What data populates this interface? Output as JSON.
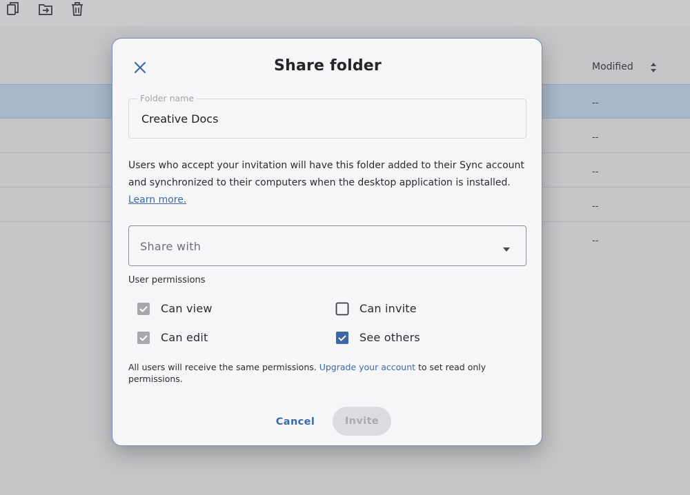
{
  "toolbar": {
    "icons": [
      "copy-icon",
      "move-to-folder-icon",
      "trash-icon"
    ]
  },
  "list": {
    "columns": {
      "modified": "Modified"
    },
    "rows": [
      {
        "modified": "--",
        "selected": true
      },
      {
        "modified": "--",
        "selected": false
      },
      {
        "modified": "--",
        "selected": false
      },
      {
        "modified": "--",
        "selected": false
      },
      {
        "modified": "--",
        "selected": false
      }
    ]
  },
  "dialog": {
    "title": "Share folder",
    "close_icon": "close-icon",
    "folder_name_label": "Folder name",
    "folder_name_value": "Creative Docs",
    "description_line1": "Users who accept your invitation will have this folder added to their Sync account",
    "description_line2": "and synchronized to their computers when the desktop application is installed.",
    "learn_more": "Learn more.",
    "share_with_placeholder": "Share with",
    "permissions_title": "User permissions",
    "permissions": [
      {
        "label": "Can view",
        "checked": true,
        "disabled": true
      },
      {
        "label": "Can invite",
        "checked": false,
        "disabled": false
      },
      {
        "label": "Can edit",
        "checked": true,
        "disabled": true
      },
      {
        "label": "See others",
        "checked": true,
        "disabled": false
      }
    ],
    "note_before": "All users will receive the same permissions. ",
    "note_link": "Upgrade your account",
    "note_after": " to set read only permissions.",
    "cancel_label": "Cancel",
    "invite_label": "Invite"
  },
  "colors": {
    "accent": "#3a69a6",
    "checkbox_checked": "#3a69a6",
    "checkbox_disabled": "#a7a7ad",
    "selected_row": "#a8b8c9"
  }
}
